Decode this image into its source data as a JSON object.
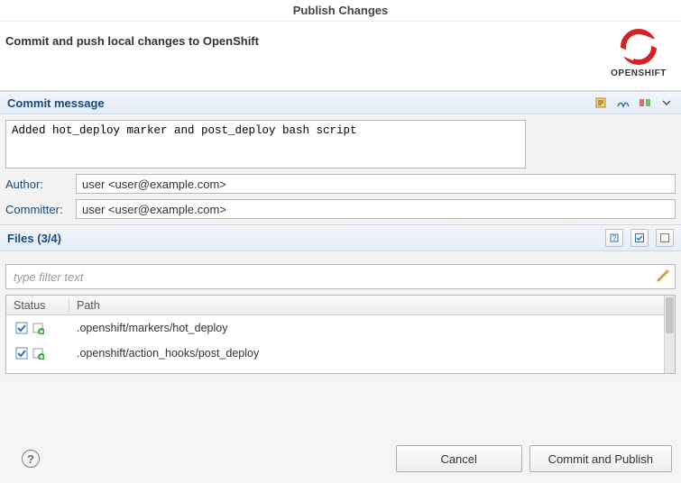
{
  "window": {
    "title": "Publish Changes"
  },
  "header": {
    "subtitle": "Commit and push local changes to OpenShift",
    "brand": "OPENSHIFT"
  },
  "commit_section": {
    "title": "Commit message",
    "message": "Added hot_deploy marker and post_deploy bash script",
    "author_label": "Author:",
    "author_value": "user <user@example.com>",
    "committer_label": "Committer:",
    "committer_value": "user <user@example.com>"
  },
  "files_section": {
    "title": "Files (3/4)",
    "filter_placeholder": "type filter text",
    "columns": {
      "status": "Status",
      "path": "Path"
    },
    "rows": [
      {
        "checked": true,
        "status_icon": "add",
        "path": ".openshift/markers/hot_deploy"
      },
      {
        "checked": true,
        "status_icon": "add",
        "path": ".openshift/action_hooks/post_deploy"
      }
    ]
  },
  "footer": {
    "cancel": "Cancel",
    "commit": "Commit and Publish"
  },
  "colors": {
    "accent_blue": "#184a7d",
    "brand_red": "#d62222"
  }
}
